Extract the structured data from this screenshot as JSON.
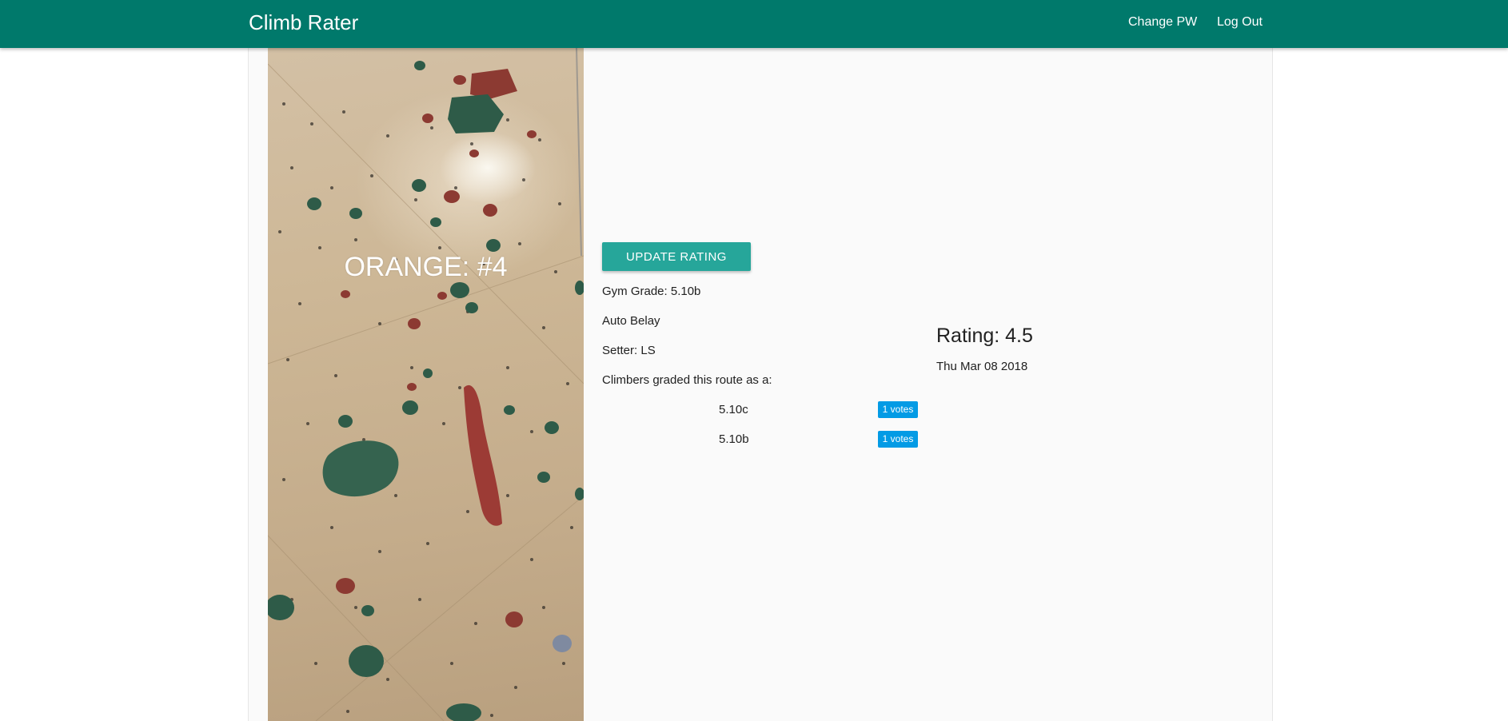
{
  "app": {
    "title": "Climb Rater"
  },
  "nav": {
    "change_pw": "Change PW",
    "log_out": "Log Out"
  },
  "route": {
    "title": "ORANGE: #4",
    "update_label": "UPDATE RATING",
    "gym_grade": "Gym Grade: 5.10b",
    "type": "Auto Belay",
    "setter": "Setter: LS",
    "graded_heading": "Climbers graded this route as a:",
    "grades": [
      {
        "grade": "5.10c",
        "votes": "1 votes"
      },
      {
        "grade": "5.10b",
        "votes": "1 votes"
      }
    ],
    "rating": "Rating: 4.5",
    "date": "Thu Mar 08 2018"
  },
  "colors": {
    "navbar": "#00796b",
    "button": "#26a69a",
    "badge": "#039be5",
    "card": "#fafafa"
  },
  "icons": {
    "route_photo": "climbing-wall-photo"
  }
}
